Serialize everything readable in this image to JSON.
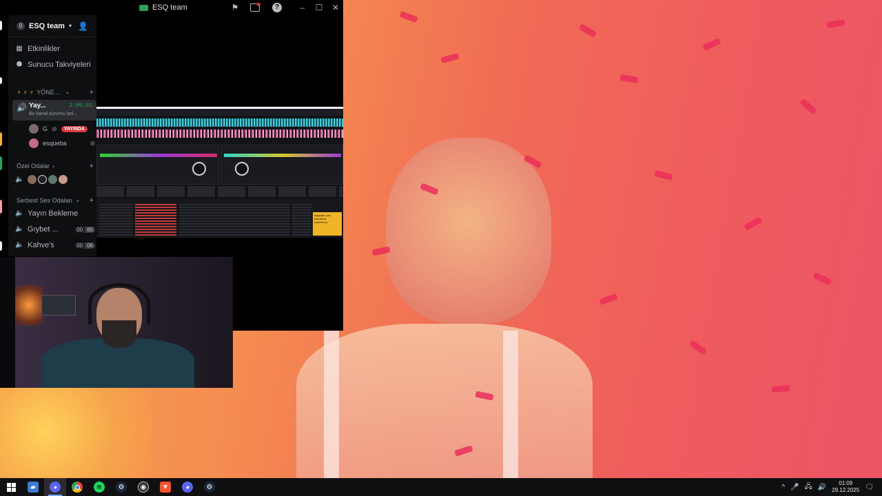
{
  "window": {
    "title": "ESQ team",
    "controls": [
      "minimize-icon",
      "maximize-icon",
      "close-icon"
    ]
  },
  "server": {
    "badge": "0",
    "name": "ESQ team"
  },
  "nav": {
    "events": "Etkinlikler",
    "boosts": "Sunucu Takviyeleri"
  },
  "categories": {
    "management": "YÖNE...",
    "private": "Özel Odalar",
    "free_voice": "Serbest Ses Odaları"
  },
  "active_channel": {
    "name": "Yay...",
    "duration": "2:06:01",
    "status": "Bir kanal durumu bel..."
  },
  "voice_users": [
    {
      "name": "G",
      "badge": "YAYINDA"
    },
    {
      "name": "esqueba"
    }
  ],
  "voice_channels": [
    {
      "name": "Yayın Bekleme"
    },
    {
      "name": "Gıybet ...",
      "count_a": "00",
      "count_b": "80"
    },
    {
      "name": "Kahve's",
      "count_a": "00",
      "count_b": "06"
    }
  ],
  "stream_ad": "Upgrade your rekordbox experience",
  "taskbar": {
    "apps": [
      "windows-start-icon",
      "explorer-icon",
      "discord-icon",
      "chrome-icon",
      "spotify-icon",
      "steam-icon",
      "obs-icon",
      "brave-icon",
      "discord-ptb-icon",
      "steam-alt-icon"
    ],
    "time": "01:09",
    "date": "29.12.2025"
  },
  "colors": {
    "accent_green": "#23a55a",
    "live_red": "#da373c",
    "bg_orange": "#f58e50",
    "bg_red": "#ee5565"
  }
}
